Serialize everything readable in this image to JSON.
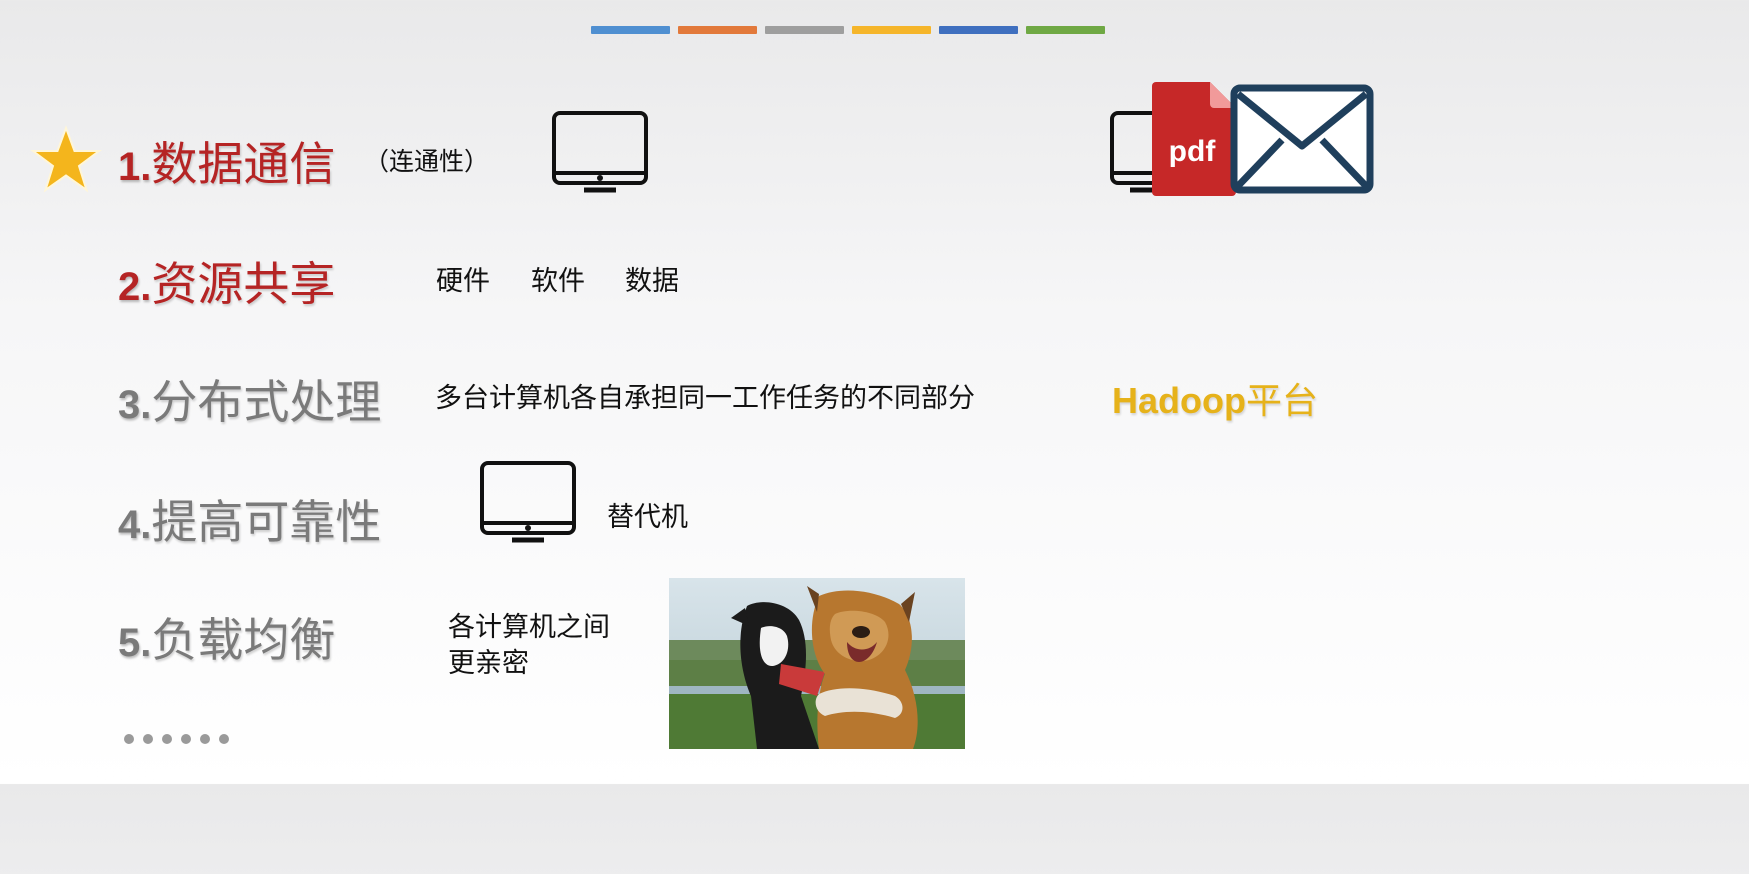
{
  "colors": {
    "bars": [
      "#4f8fd1",
      "#e2793b",
      "#9e9e9e",
      "#f5b52a",
      "#3f6fbf",
      "#6fa844"
    ],
    "active_title": "#b52424",
    "inactive_title": "#7a7a7a",
    "hadoop": "#e6b21a"
  },
  "items": [
    {
      "num": "1.",
      "title": "数据通信",
      "paren": "（连通性）"
    },
    {
      "num": "2.",
      "title": "资源共享",
      "subs": [
        "硬件",
        "软件",
        "数据"
      ]
    },
    {
      "num": "3.",
      "title": "分布式处理",
      "desc": "多台计算机各自承担同一工作任务的不同部分"
    },
    {
      "num": "4.",
      "title": "提高可靠性",
      "desc": "替代机"
    },
    {
      "num": "5.",
      "title": "负载均衡",
      "desc_line1": "各计算机之间",
      "desc_line2": "更亲密"
    }
  ],
  "hadoop": {
    "latin": "Hadoop",
    "cn": "平台"
  },
  "pdf_label": "pdf",
  "ellipsis_count": 6,
  "icons": [
    "star-icon",
    "monitor-icon",
    "pdf-file-icon",
    "envelope-icon"
  ]
}
